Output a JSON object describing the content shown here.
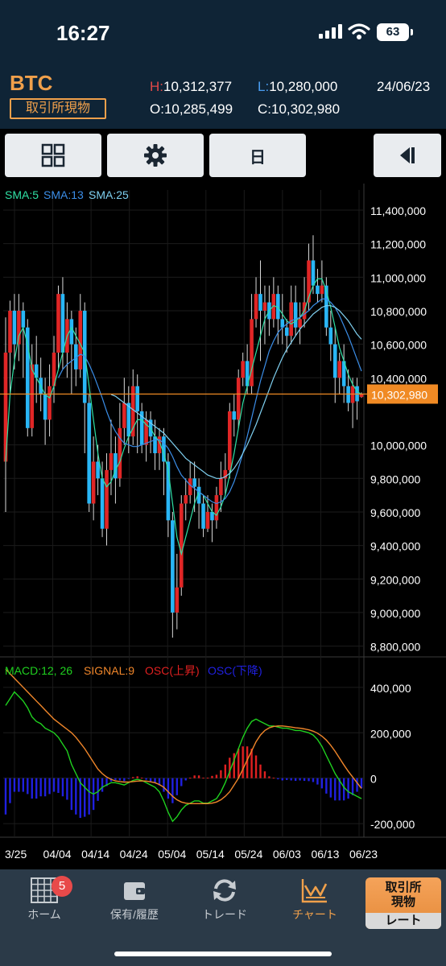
{
  "status_bar": {
    "time": "16:27",
    "battery": "63"
  },
  "header": {
    "symbol": "BTC",
    "market": "取引所現物",
    "high_key": "H:",
    "high": "10,312,377",
    "low_key": "L:",
    "low": "10,280,000",
    "open_key": "O:",
    "open": "10,285,499",
    "close_key": "C:",
    "close": "10,302,980",
    "date": "24/06/23"
  },
  "toolbar": {
    "period_label": "日",
    "icons": [
      "grid-icon",
      "gear-icon",
      "collapse-left-icon"
    ]
  },
  "colors": {
    "up": "#e02626",
    "down": "#29b6f6",
    "sma5": "#2fe0a4",
    "sma13": "#3b8ee8",
    "sma25": "#7fd0f0",
    "macd": "#1fd11f",
    "signal": "#f0862a",
    "osc_up": "#e02020",
    "osc_down": "#2020e0",
    "current_price": "#f08a24",
    "accent": "#f0a04b"
  },
  "chart_data": [
    {
      "type": "candlestick",
      "legend": [
        {
          "name": "SMA:5"
        },
        {
          "name": "SMA:13"
        },
        {
          "name": "SMA:25"
        }
      ],
      "y_ticks": [
        "11,400,000",
        "11,200,000",
        "11,000,000",
        "10,800,000",
        "10,600,000",
        "10,400,000",
        "10,000,000",
        "9,800,000",
        "9,600,000",
        "9,400,000",
        "9,200,000",
        "9,000,000",
        "8,800,000"
      ],
      "y_tick_values": [
        11400000,
        11200000,
        11000000,
        10800000,
        10600000,
        10400000,
        10000000,
        9800000,
        9600000,
        9400000,
        9200000,
        9000000,
        8800000
      ],
      "ylim": [
        8750000,
        11520000
      ],
      "current_price_label": "10,302,980",
      "current_price": 10302980,
      "x_ticks": [
        "3/25",
        "04/04",
        "04/14",
        "04/24",
        "05/04",
        "05/14",
        "05/24",
        "06/03",
        "06/13",
        "06/23"
      ],
      "candles": [
        [
          9900000,
          10550000,
          9600000,
          10760000
        ],
        [
          10550000,
          10800000,
          10300000,
          10860000
        ],
        [
          10800000,
          10600000,
          10450000,
          10900000
        ],
        [
          10600000,
          10800000,
          10500000,
          10900000
        ],
        [
          10800000,
          10700000,
          10400000,
          10850000
        ],
        [
          10700000,
          10100000,
          10050000,
          10750000
        ],
        [
          10100000,
          10480000,
          10050000,
          10600000
        ],
        [
          10480000,
          10400000,
          10250000,
          10650000
        ],
        [
          10400000,
          10300000,
          10200000,
          10520000
        ],
        [
          10300000,
          10150000,
          10000000,
          10400000
        ],
        [
          10150000,
          10350000,
          10050000,
          10480000
        ],
        [
          10350000,
          10550000,
          10250000,
          10650000
        ],
        [
          10550000,
          10900000,
          10450000,
          10950000
        ],
        [
          10900000,
          10550000,
          10450000,
          11000000
        ],
        [
          10550000,
          10750000,
          10400000,
          10850000
        ],
        [
          10750000,
          10600000,
          10300000,
          10800000
        ],
        [
          10600000,
          10450000,
          10350000,
          10700000
        ],
        [
          10450000,
          10800000,
          10400000,
          10900000
        ],
        [
          10800000,
          10250000,
          9950000,
          10850000
        ],
        [
          10250000,
          9650000,
          9600000,
          10300000
        ],
        [
          9650000,
          9900000,
          9550000,
          10050000
        ],
        [
          9900000,
          9800000,
          9700000,
          10000000
        ],
        [
          9800000,
          9500000,
          9450000,
          9900000
        ],
        [
          9500000,
          9850000,
          9400000,
          9950000
        ],
        [
          9850000,
          9950000,
          9700000,
          10150000
        ],
        [
          9950000,
          9800000,
          9650000,
          10050000
        ],
        [
          9800000,
          10100000,
          9750000,
          10250000
        ],
        [
          10100000,
          10250000,
          10000000,
          10400000
        ],
        [
          10250000,
          10050000,
          9950000,
          10350000
        ],
        [
          10050000,
          10350000,
          10000000,
          10450000
        ],
        [
          10350000,
          10200000,
          9950000,
          10420000
        ],
        [
          10200000,
          10000000,
          9950000,
          10250000
        ],
        [
          10000000,
          10150000,
          9900000,
          10200000
        ],
        [
          10150000,
          10050000,
          9950000,
          10200000
        ],
        [
          10050000,
          9950000,
          9850000,
          10150000
        ],
        [
          9950000,
          10050000,
          9850000,
          10100000
        ],
        [
          10050000,
          9900000,
          9700000,
          10100000
        ],
        [
          9900000,
          9550000,
          9450000,
          9950000
        ],
        [
          9550000,
          9000000,
          8850000,
          9600000
        ],
        [
          9000000,
          9150000,
          8900000,
          9350000
        ],
        [
          9150000,
          9650000,
          9100000,
          9700000
        ],
        [
          9650000,
          9700000,
          9550000,
          9800000
        ],
        [
          9700000,
          9800000,
          9650000,
          9900000
        ],
        [
          9800000,
          9750000,
          9600000,
          9900000
        ],
        [
          9750000,
          9650000,
          9500000,
          9800000
        ],
        [
          9650000,
          9500000,
          9450000,
          9700000
        ],
        [
          9500000,
          9600000,
          9480000,
          9700000
        ],
        [
          9600000,
          9550000,
          9420000,
          9650000
        ],
        [
          9550000,
          9700000,
          9500000,
          9750000
        ],
        [
          9700000,
          9800000,
          9600000,
          9900000
        ],
        [
          9800000,
          9850000,
          9700000,
          9950000
        ],
        [
          9850000,
          10200000,
          9800000,
          10250000
        ],
        [
          10200000,
          10150000,
          10050000,
          10300000
        ],
        [
          10150000,
          10400000,
          10100000,
          10450000
        ],
        [
          10400000,
          10500000,
          10350000,
          10550000
        ],
        [
          10500000,
          10350000,
          10300000,
          10600000
        ],
        [
          10350000,
          10750000,
          10300000,
          10900000
        ],
        [
          10750000,
          10900000,
          10700000,
          11000000
        ],
        [
          10900000,
          10800000,
          10500000,
          11100000
        ],
        [
          10800000,
          10850000,
          10600000,
          10950000
        ],
        [
          10850000,
          10750000,
          10650000,
          10950000
        ],
        [
          10750000,
          10900000,
          10700000,
          11000000
        ],
        [
          10900000,
          10750000,
          10600000,
          10950000
        ],
        [
          10750000,
          10700000,
          10600000,
          10900000
        ],
        [
          10700000,
          10650000,
          10550000,
          10750000
        ],
        [
          10650000,
          10850000,
          10600000,
          10950000
        ],
        [
          10850000,
          10700000,
          10650000,
          10950000
        ],
        [
          10700000,
          10750000,
          10600000,
          10850000
        ],
        [
          10750000,
          10850000,
          10700000,
          11000000
        ],
        [
          10850000,
          11100000,
          10800000,
          11200000
        ],
        [
          11100000,
          10950000,
          10900000,
          11250000
        ],
        [
          10950000,
          10900000,
          10850000,
          11050000
        ],
        [
          10900000,
          10950000,
          10850000,
          11100000
        ],
        [
          10950000,
          10700000,
          10650000,
          11000000
        ],
        [
          10700000,
          10600000,
          10500000,
          10800000
        ],
        [
          10600000,
          10400000,
          10250000,
          10700000
        ],
        [
          10400000,
          10500000,
          10300000,
          10550000
        ],
        [
          10500000,
          10350000,
          10250000,
          10600000
        ],
        [
          10350000,
          10250000,
          10200000,
          10450000
        ],
        [
          10250000,
          10350000,
          10100000,
          10400000
        ],
        [
          10350000,
          10260000,
          10150000,
          10400000
        ],
        [
          10285499,
          10302980,
          10280000,
          10312377
        ]
      ],
      "series": [
        {
          "name": "SMA:5",
          "values": [
            9900000,
            10300000,
            10500000,
            10650000,
            10700000,
            10600000,
            10450000,
            10400000,
            10350000,
            10300000,
            10280000,
            10350000,
            10450000,
            10550000,
            10650000,
            10700000,
            10650000,
            10600000,
            10550000,
            10350000,
            10150000,
            9950000,
            9800000,
            9750000,
            9780000,
            9850000,
            9900000,
            9980000,
            10050000,
            10100000,
            10150000,
            10150000,
            10120000,
            10100000,
            10050000,
            10020000,
            9950000,
            9850000,
            9650000,
            9450000,
            9350000,
            9450000,
            9550000,
            9650000,
            9720000,
            9700000,
            9650000,
            9600000,
            9580000,
            9630000,
            9700000,
            9820000,
            9950000,
            10100000,
            10250000,
            10350000,
            10450000,
            10550000,
            10650000,
            10750000,
            10800000,
            10830000,
            10820000,
            10780000,
            10740000,
            10720000,
            10740000,
            10760000,
            10800000,
            10880000,
            10950000,
            10990000,
            10990000,
            10920000,
            10820000,
            10700000,
            10580000,
            10500000,
            10420000,
            10360000,
            10320000,
            10300000
          ]
        },
        {
          "name": "SMA:13",
          "values": [
            null,
            null,
            null,
            null,
            null,
            null,
            null,
            null,
            null,
            null,
            null,
            null,
            10400000,
            10450000,
            10480000,
            10500000,
            10520000,
            10540000,
            10530000,
            10480000,
            10420000,
            10350000,
            10280000,
            10200000,
            10130000,
            10080000,
            10040000,
            10010000,
            10000000,
            9990000,
            9990000,
            10000000,
            10010000,
            10020000,
            10030000,
            10030000,
            10010000,
            9980000,
            9930000,
            9870000,
            9820000,
            9790000,
            9760000,
            9740000,
            9720000,
            9700000,
            9680000,
            9660000,
            9650000,
            9660000,
            9680000,
            9720000,
            9780000,
            9860000,
            9950000,
            10050000,
            10160000,
            10270000,
            10380000,
            10470000,
            10560000,
            10620000,
            10670000,
            10700000,
            10720000,
            10740000,
            10750000,
            10760000,
            10780000,
            10800000,
            10830000,
            10850000,
            10870000,
            10870000,
            10850000,
            10820000,
            10770000,
            10710000,
            10650000,
            10580000,
            10510000,
            10440000
          ]
        },
        {
          "name": "SMA:25",
          "values": [
            null,
            null,
            null,
            null,
            null,
            null,
            null,
            null,
            null,
            null,
            null,
            null,
            null,
            null,
            null,
            null,
            null,
            null,
            null,
            null,
            null,
            null,
            null,
            null,
            10300000,
            10290000,
            10270000,
            10250000,
            10230000,
            10210000,
            10190000,
            10170000,
            10150000,
            10130000,
            10110000,
            10090000,
            10070000,
            10040000,
            10010000,
            9980000,
            9950000,
            9920000,
            9900000,
            9880000,
            9860000,
            9840000,
            9820000,
            9810000,
            9800000,
            9800000,
            9810000,
            9830000,
            9860000,
            9900000,
            9950000,
            10000000,
            10060000,
            10120000,
            10190000,
            10260000,
            10330000,
            10400000,
            10460000,
            10520000,
            10570000,
            10610000,
            10650000,
            10690000,
            10720000,
            10750000,
            10780000,
            10800000,
            10820000,
            10830000,
            10830000,
            10820000,
            10800000,
            10770000,
            10740000,
            10700000,
            10660000,
            10630000
          ]
        }
      ]
    },
    {
      "type": "macd",
      "legend": [
        {
          "name": "MACD:12, 26"
        },
        {
          "name": "SIGNAL:9"
        },
        {
          "name": "OSC(上昇)"
        },
        {
          "name": "OSC(下降)"
        }
      ],
      "y_ticks": [
        "400,000",
        "200,000",
        "0",
        "-200,000"
      ],
      "y_tick_values": [
        400000,
        200000,
        0,
        -200000
      ],
      "ylim": [
        -260000,
        520000
      ],
      "series": [
        {
          "name": "MACD",
          "values": [
            320000,
            350000,
            380000,
            360000,
            340000,
            310000,
            270000,
            250000,
            240000,
            220000,
            210000,
            200000,
            180000,
            150000,
            120000,
            60000,
            20000,
            -20000,
            -40000,
            -60000,
            -70000,
            -60000,
            -40000,
            -30000,
            -20000,
            -20000,
            -25000,
            -30000,
            -20000,
            -10000,
            -5000,
            -10000,
            -20000,
            -30000,
            -40000,
            -60000,
            -100000,
            -150000,
            -190000,
            -170000,
            -140000,
            -120000,
            -110000,
            -100000,
            -100000,
            -110000,
            -110000,
            -100000,
            -90000,
            -60000,
            -20000,
            30000,
            80000,
            130000,
            180000,
            220000,
            250000,
            260000,
            250000,
            240000,
            230000,
            230000,
            225000,
            220000,
            220000,
            215000,
            210000,
            210000,
            205000,
            200000,
            190000,
            170000,
            140000,
            100000,
            60000,
            20000,
            -10000,
            -40000,
            -60000,
            -70000,
            -80000,
            -90000
          ]
        },
        {
          "name": "SIGNAL",
          "values": [
            480000,
            460000,
            440000,
            420000,
            400000,
            380000,
            360000,
            340000,
            320000,
            300000,
            280000,
            260000,
            245000,
            230000,
            215000,
            200000,
            180000,
            155000,
            130000,
            100000,
            70000,
            40000,
            20000,
            5000,
            -5000,
            -12000,
            -15000,
            -17000,
            -17000,
            -15000,
            -13000,
            -12000,
            -13000,
            -16000,
            -20000,
            -28000,
            -40000,
            -60000,
            -80000,
            -95000,
            -105000,
            -110000,
            -112000,
            -112000,
            -112000,
            -112000,
            -112000,
            -110000,
            -105000,
            -95000,
            -80000,
            -60000,
            -30000,
            0,
            40000,
            80000,
            120000,
            160000,
            190000,
            210000,
            222000,
            228000,
            230000,
            230000,
            228000,
            225000,
            222000,
            220000,
            217000,
            213000,
            207000,
            198000,
            185000,
            168000,
            145000,
            118000,
            88000,
            58000,
            30000,
            5000,
            -20000,
            -45000
          ]
        }
      ]
    }
  ],
  "tabbar": {
    "home_label": "ホーム",
    "home_badge": "5",
    "holdings_label": "保有/履歴",
    "trade_label": "トレード",
    "chart_label": "チャート",
    "rate_top": "取引所\n現物",
    "rate_top_1": "取引所",
    "rate_top_2": "現物",
    "rate_bottom": "レート"
  }
}
